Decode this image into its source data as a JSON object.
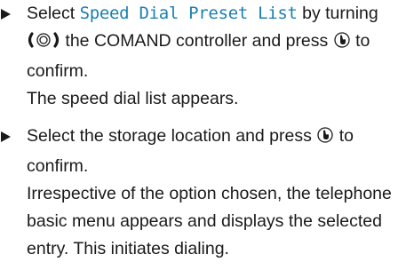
{
  "steps": [
    {
      "text_before": "Select ",
      "menu_item": "Speed Dial Preset List",
      "text_mid1": " by turning ",
      "icon_turn": "turn-controller-icon",
      "text_mid2": " the COMAND controller and press ",
      "icon_press": "press-controller-icon",
      "text_after": " to confirm.",
      "result": "The speed dial list appears."
    },
    {
      "text_before": "Select the storage location and press ",
      "icon_press": "press-controller-icon",
      "text_after": " to confirm.",
      "result": "Irrespective of the option chosen, the telephone basic menu appears and displays the selected entry. This initiates dialing."
    }
  ],
  "colors": {
    "text": "#1a1a1a",
    "menu_item": "#1a7fae"
  }
}
